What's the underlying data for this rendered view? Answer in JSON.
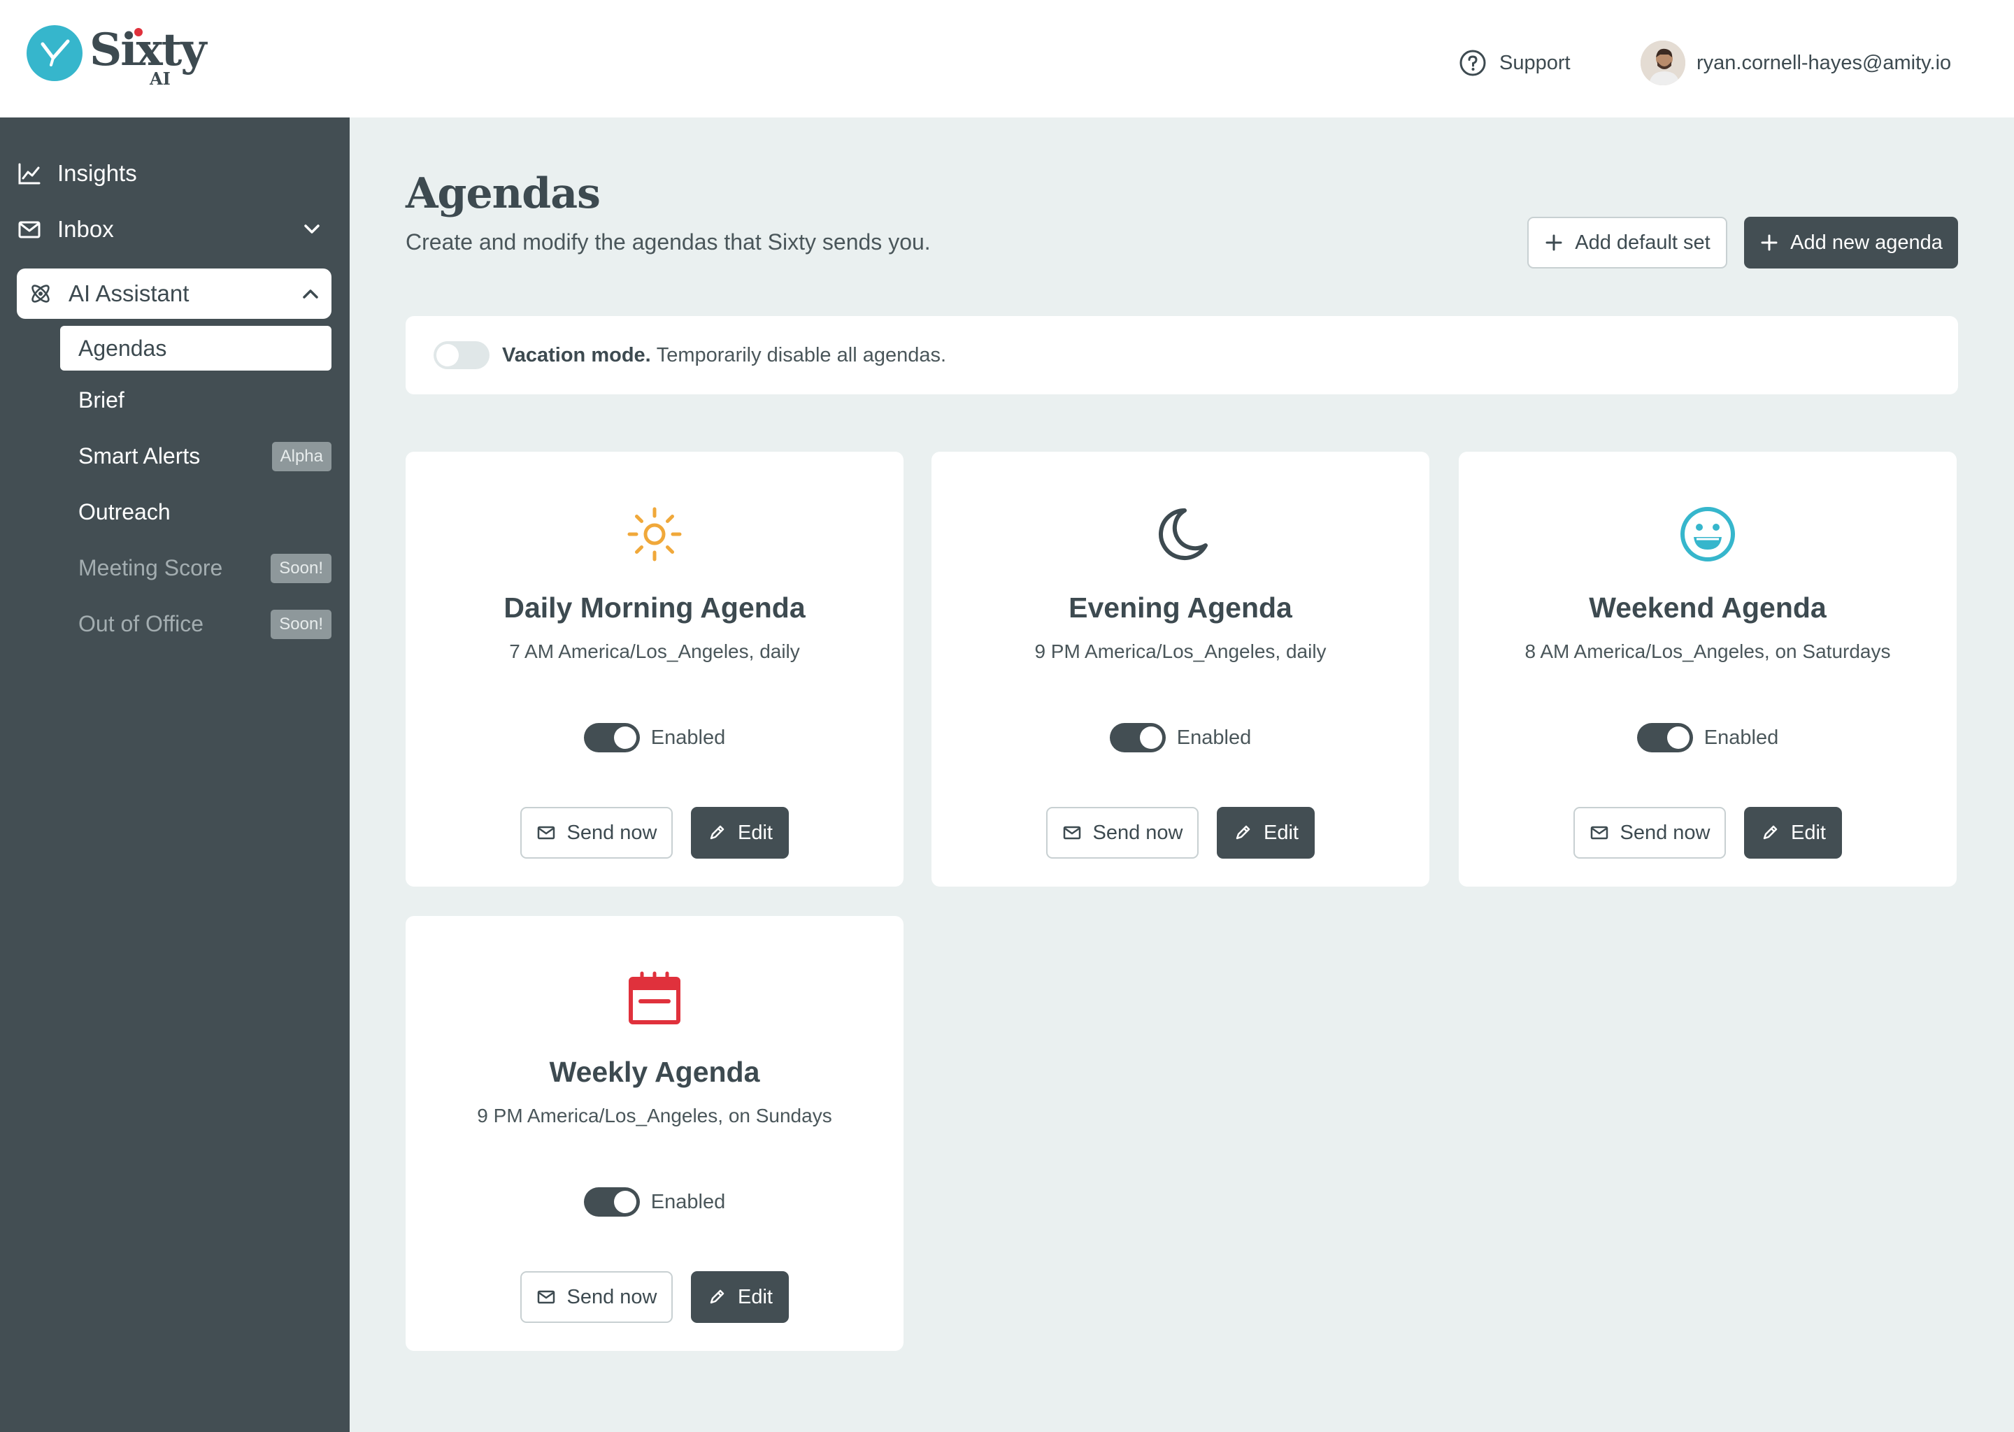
{
  "brand": {
    "name": "Sixty",
    "sub": "AI"
  },
  "header": {
    "support_label": "Support",
    "user_email": "ryan.cornell-hayes@amity.io"
  },
  "sidebar": {
    "items": [
      {
        "label": "Insights",
        "icon": "chart-line-icon"
      },
      {
        "label": "Inbox",
        "icon": "mail-icon"
      },
      {
        "label": "AI Assistant",
        "icon": "atom-icon"
      }
    ],
    "subitems": [
      {
        "label": "Agendas"
      },
      {
        "label": "Brief"
      },
      {
        "label": "Smart Alerts",
        "badge": "Alpha"
      },
      {
        "label": "Outreach"
      },
      {
        "label": "Meeting Score",
        "badge": "Soon!"
      },
      {
        "label": "Out of Office",
        "badge": "Soon!"
      }
    ]
  },
  "page": {
    "title": "Agendas",
    "subtitle": "Create and modify the agendas that Sixty sends you.",
    "add_default_label": "Add default set",
    "add_new_label": "Add new agenda"
  },
  "vacation": {
    "title": "Vacation mode.",
    "description": "Temporarily disable all agendas.",
    "enabled": false
  },
  "agendas": [
    {
      "name": "Daily Morning Agenda",
      "schedule": "7 AM America/Los_Angeles, daily",
      "status": "Enabled",
      "icon": "sun-icon",
      "color": "#f0a83a"
    },
    {
      "name": "Evening Agenda",
      "schedule": "9 PM America/Los_Angeles, daily",
      "status": "Enabled",
      "icon": "moon-icon",
      "color": "#3d4a50"
    },
    {
      "name": "Weekend Agenda",
      "schedule": "8 AM America/Los_Angeles, on Saturdays",
      "status": "Enabled",
      "icon": "smiley-icon",
      "color": "#36b6cc"
    },
    {
      "name": "Weekly Agenda",
      "schedule": "9 PM America/Los_Angeles, on Sundays",
      "status": "Enabled",
      "icon": "calendar-icon",
      "color": "#e0313c"
    }
  ],
  "card_actions": {
    "send_label": "Send now",
    "edit_label": "Edit"
  },
  "colors": {
    "sidebar": "#434e53",
    "background": "#eaf0f0",
    "accent": "#36b6cc"
  }
}
